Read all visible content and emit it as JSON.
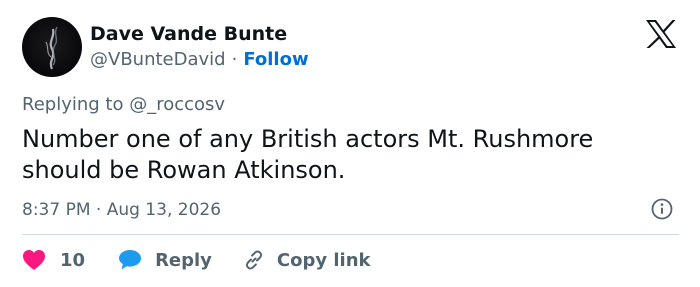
{
  "author": {
    "display_name": "Dave Vande Bunte",
    "handle": "@VBunteDavid",
    "separator": "·",
    "follow_label": "Follow"
  },
  "tweet": {
    "replying_to": "Replying to @_roccosv",
    "text": "Number one of any British actors Mt. Rushmore should be Rowan Atkinson.",
    "timestamp": "8:37 PM · Aug 13, 2026"
  },
  "actions": {
    "like_count": "10",
    "reply_label": "Reply",
    "copy_link_label": "Copy link"
  },
  "icons": {
    "logo": "x-logo-icon",
    "info": "info-icon",
    "like": "heart-icon",
    "reply": "speech-bubble-icon",
    "copy": "link-icon"
  },
  "colors": {
    "text_primary": "#0f1419",
    "text_secondary": "#536471",
    "follow": "#006fd6",
    "heart": "#f91880",
    "reply_bubble": "#1d9bf0",
    "divider": "#cfd9de"
  }
}
